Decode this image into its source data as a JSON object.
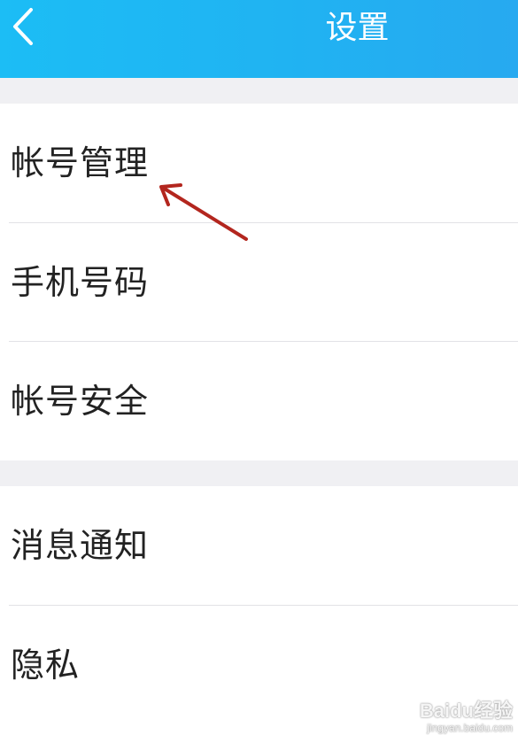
{
  "header": {
    "title": "设置",
    "background": "#20b3f2",
    "back_icon": "chevron-left-icon"
  },
  "groups": [
    {
      "items": [
        {
          "label": "帐号管理"
        },
        {
          "label": "手机号码"
        },
        {
          "label": "帐号安全"
        }
      ]
    },
    {
      "items": [
        {
          "label": "消息通知"
        },
        {
          "label": "隐私"
        }
      ]
    }
  ],
  "annotation": {
    "arrow_color": "#b3261e"
  },
  "watermark": {
    "text": "Baidu经验",
    "sub": "jingyan.baidu.com"
  }
}
